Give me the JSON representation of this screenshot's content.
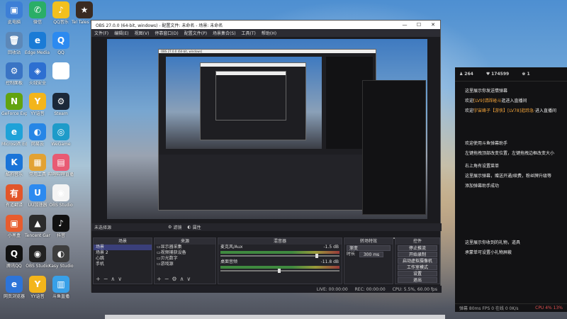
{
  "desktop_icons": [
    {
      "label": "此电脑",
      "color": "#3d7fd6",
      "glyph": "▣"
    },
    {
      "label": "微信",
      "color": "#2aae67",
      "glyph": "✆"
    },
    {
      "label": "QQ音乐",
      "color": "#f2c01e",
      "glyph": "♪"
    },
    {
      "label": "Tel Tales Moguri Bala",
      "color": "#3a2b22",
      "glyph": "★"
    },
    {
      "label": "回收站",
      "color": "#5d88b8",
      "glyph": "🗑"
    },
    {
      "label": "Edge Media Center",
      "color": "#1a7bd6",
      "glyph": "e"
    },
    {
      "label": "QQ",
      "color": "#2c8af0",
      "glyph": "Q"
    },
    {
      "label": "控制面板",
      "color": "#3a74c4",
      "glyph": "⚙"
    },
    {
      "label": "火绒安全",
      "color": "#2d6fd1",
      "glyph": "◈"
    },
    {
      "label": "",
      "color": "#ffffff",
      "glyph": ""
    },
    {
      "label": "GeForce Experience",
      "color": "#62a30f",
      "glyph": "N"
    },
    {
      "label": "YY语音",
      "color": "#f3b51b",
      "glyph": "Y"
    },
    {
      "label": "Steam",
      "color": "#1b2838",
      "glyph": "⚙"
    },
    {
      "label": "Microsoft Edge",
      "color": "#1fa2d8",
      "glyph": "e"
    },
    {
      "label": "网易云",
      "color": "#2686e6",
      "glyph": "◐"
    },
    {
      "label": "WeGame",
      "color": "#1e9bc9",
      "glyph": "◎"
    },
    {
      "label": "酷狗音乐",
      "color": "#1a74d8",
      "glyph": "K"
    },
    {
      "label": "常用工具",
      "color": "#e2a233",
      "glyph": "▦"
    },
    {
      "label": "哔哩哔哩直播姬",
      "color": "#e85a73",
      "glyph": "▤"
    },
    {
      "label": "有道翻译",
      "color": "#e2562a",
      "glyph": "有"
    },
    {
      "label": "UU加速器",
      "color": "#2c8af0",
      "glyph": "U"
    },
    {
      "label": "OBS Studio",
      "color": "#f4f4f4",
      "glyph": "◉"
    },
    {
      "label": "小黑盒",
      "color": "#e75c2e",
      "glyph": "▣"
    },
    {
      "label": "Tencent Games",
      "color": "#2b2b2b",
      "glyph": "▲"
    },
    {
      "label": "抖音",
      "color": "#111111",
      "glyph": "♪"
    },
    {
      "label": "腾讯QQ",
      "color": "#111111",
      "glyph": "Q"
    },
    {
      "label": "OBS Studio",
      "color": "#222222",
      "glyph": "◉"
    },
    {
      "label": "Kasy Studio",
      "color": "#3e3e3e",
      "glyph": "◐"
    },
    {
      "label": "网页浏览器",
      "color": "#2d74d8",
      "glyph": "e"
    },
    {
      "label": "YY语音",
      "color": "#f3b51b",
      "glyph": "Y"
    },
    {
      "label": "斗鱼直播",
      "color": "#38a0e8",
      "glyph": "▥"
    }
  ],
  "obs": {
    "title": "OBS 27.0.0 (64-bit, windows) - 配置文件: 未命名 - 场景: 未命名",
    "window_buttons": [
      "—",
      "☐",
      "✕"
    ],
    "menu": [
      "文件(F)",
      "编辑(E)",
      "视图(V)",
      "停靠窗口(D)",
      "配置文件(P)",
      "场景集合(S)",
      "工具(T)",
      "帮助(H)"
    ],
    "preview_nested_title": "OBS 27.0.0 (64-bit, windows)",
    "toolbar": {
      "filter_label": "滤镜",
      "settings_label": "属性"
    },
    "scene_source_bar": "未选择源",
    "panels": {
      "scenes": {
        "title": "场景",
        "items": [
          "场景",
          "场景 2",
          "心跳",
          "手机"
        ],
        "selected": 0
      },
      "sources": {
        "title": "来源",
        "items": [
          "显示器采集",
          "视频捕获设备",
          "贝光数字",
          "游戏源"
        ]
      },
      "mixer": {
        "title": "混音器",
        "tracks": [
          {
            "name": "麦克风/Aux",
            "db": "-1.5 dB"
          },
          {
            "name": "桌面音频",
            "db": "-11.8 dB"
          }
        ]
      },
      "transitions": {
        "title": "转场特效",
        "type": "渐变",
        "duration_label": "时长",
        "duration": "300 ms"
      },
      "controls": {
        "title": "控件",
        "buttons": [
          "停止推流",
          "开始录制",
          "启动虚拟摄像机",
          "工作室模式",
          "设置",
          "退出"
        ]
      }
    },
    "status": {
      "live": "LIVE: 00:00:00",
      "rec": "REC: 00:00:00",
      "cpu": "CPU: 5.5%, 60.00 fps"
    }
  },
  "chat": {
    "top": {
      "fans": "264",
      "likes": "174599",
      "online": "1"
    },
    "messages": [
      {
        "text": "这里展示你发送情弹幕",
        "highlight": ""
      },
      {
        "text": "欢迎",
        "highlight": "[LV9]请踩碰斗",
        "after": "逛进入直播间"
      },
      {
        "text": "欢迎",
        "highlight": "宇宙峰子【游侠】[LV78]逛踪急·",
        "after": "进入直播间"
      },
      {
        "text": "欢迎使用斗鱼弹幕助手",
        "highlight": ""
      },
      {
        "text": "左键拖拽顶部改变位置，左键拖拽边框改变大小",
        "highlight": ""
      },
      {
        "text": "右上角有设置菜单",
        "highlight": ""
      },
      {
        "text": "这里展示弹幕，赠送开通/续费，粉丝牌升级等",
        "highlight": ""
      },
      {
        "text": "添加弹幕助手成功",
        "highlight": ""
      },
      {
        "text": "这里展示你收到的礼物，道具",
        "highlight": ""
      },
      {
        "text": "承蒙单可设置小礼物屏蔽",
        "highlight": ""
      }
    ],
    "footer": "弹幕 80ms FPS 0 在线 0 0K/s",
    "cpu": "CPU 4% 13%"
  }
}
